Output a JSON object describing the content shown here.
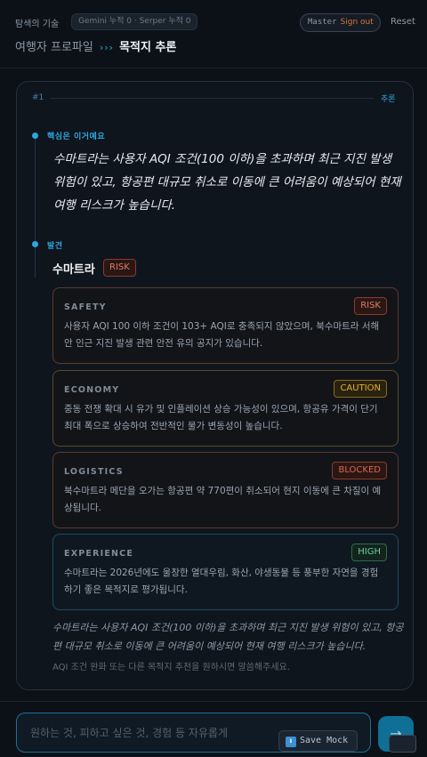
{
  "header": {
    "brand": "탐색의 기술",
    "counter": "Gemini 누적 0 · Serper 누적 0",
    "user": "Master",
    "sign_out": "Sign out",
    "reset": "Reset",
    "breadcrumb_profile": "여행자 프로파일",
    "breadcrumb_sep": "›››",
    "breadcrumb_current": "목적지 추론"
  },
  "card": {
    "number": "#1",
    "label": "추론",
    "core_label": "핵심은 이거예요",
    "core_text": "수마트라는 사용자 AQI 조건(100 이하)을 초과하며 최근 지진 발생 위험이 있고, 항공편 대규모 취소로 이동에 큰 어려움이 예상되어 현재 여행 리스크가 높습니다.",
    "discovery_label": "발견",
    "place": "수마트라",
    "place_badge": "RISK",
    "findings": [
      {
        "category": "SAFETY",
        "badge": "RISK",
        "text": "사용자 AQI 100 이하 조건이 103+ AQI로 충족되지 않았으며, 북수마트라 서해안 인근 지진 발생 관련 안전 유의 공지가 있습니다."
      },
      {
        "category": "ECONOMY",
        "badge": "CAUTION",
        "text": "중동 전쟁 확대 시 유가 및 인플레이션 상승 가능성이 있으며, 항공유 가격이 단기 최대 폭으로 상승하여 전반적인 물가 변동성이 높습니다."
      },
      {
        "category": "LOGISTICS",
        "badge": "BLOCKED",
        "text": "북수마트라 메단을 오가는 항공편 약 770편이 취소되어 현지 이동에 큰 차질이 예상됩니다."
      },
      {
        "category": "EXPERIENCE",
        "badge": "HIGH",
        "text": "수마트라는 2026년에도 울창한 열대우림, 화산, 야생동물 등 풍부한 자연을 경험하기 좋은 목적지로 평가됩니다."
      }
    ],
    "summary": "수마트라는 사용자 AQI 조건(100 이하)을 초과하며 최근 지진 발생 위험이 있고, 항공편 대규모 취소로 이동에 큰 어려움이 예상되어 현재 여행 리스크가 높습니다.",
    "followup": "AQI 조건 완화 또는 다른 목적지 추천을 원하시면 말씀해주세요."
  },
  "composer": {
    "placeholder": "원하는 것, 피하고 싶은 것, 경험 등 자유롭게",
    "save_mock": "Save Mock",
    "save_icon": "⬇",
    "send_icon": "→"
  },
  "colors": {
    "accent": "#2ea6df",
    "risk": "#e07a67",
    "caution": "#e0b02e",
    "blocked": "#e0634d",
    "high": "#6fcf97"
  }
}
